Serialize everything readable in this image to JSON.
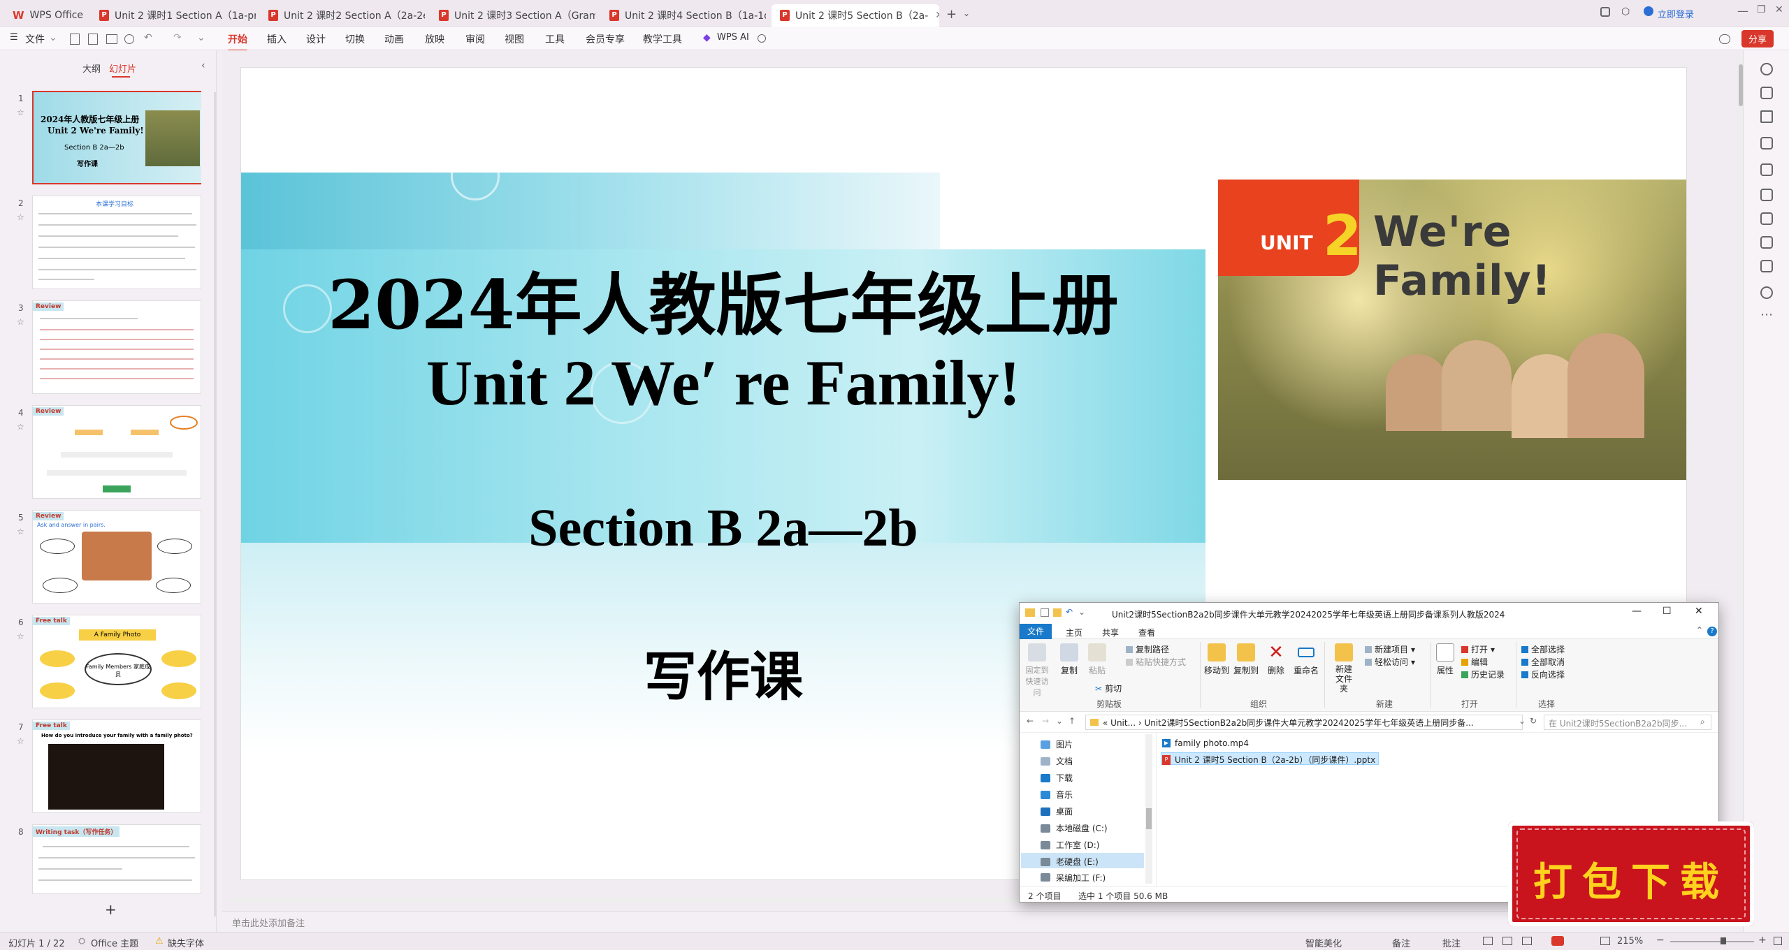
{
  "tabs": [
    {
      "label": "WPS Office",
      "type": "home"
    },
    {
      "label": "Unit 2 课时1 Section A（1a-pronun",
      "type": "ppt"
    },
    {
      "label": "Unit 2 课时2 Section A（2a-2e）",
      "type": "ppt"
    },
    {
      "label": "Unit 2 课时3 Section A（Grammar",
      "type": "ppt"
    },
    {
      "label": "Unit 2 课时4 Section B（1a-1d）",
      "type": "ppt"
    },
    {
      "label": "Unit 2 课时5 Section B（2a-",
      "type": "ppt",
      "active": true
    }
  ],
  "titlebar": {
    "login": "立即登录",
    "share": "分享"
  },
  "ribbon": {
    "file": "文件",
    "items": [
      "开始",
      "插入",
      "设计",
      "切换",
      "动画",
      "放映",
      "审阅",
      "视图",
      "工具",
      "会员专享",
      "教学工具"
    ],
    "active": "开始",
    "wps_ai": "WPS AI"
  },
  "leftpanel": {
    "tabs": [
      "大纲",
      "幻灯片"
    ],
    "active_tab": "幻灯片",
    "thumbs": [
      {
        "num": "1",
        "title": "2024年人教版七年级上册",
        "subtitle": "Unit 2 We're Family!",
        "section": "Section B 2a—2b",
        "footer": "写作课"
      },
      {
        "num": "2",
        "title": "本课学习目标"
      },
      {
        "num": "3",
        "title": "Review"
      },
      {
        "num": "4",
        "title": "Review"
      },
      {
        "num": "5",
        "title": "Review",
        "subtitle": "Ask and answer in pairs."
      },
      {
        "num": "6",
        "title": "Free talk",
        "subtitle": "A Family Photo",
        "center": "Family Members 家庭成员"
      },
      {
        "num": "7",
        "title": "Free talk",
        "subtitle": "How do you introduce your family with a family photo?"
      },
      {
        "num": "8",
        "title": "Writing task（写作任务）"
      }
    ],
    "add_icon": "plus-icon"
  },
  "slide": {
    "line1": "2024年人教版七年级上册",
    "line2": "Unit 2 We′ re Family!",
    "line3": "Section B 2a—2b",
    "line4": "写作课",
    "banner_unit": "UNIT",
    "banner_num": "2",
    "banner_title": "We're Family!"
  },
  "notes_placeholder": "单击此处添加备注",
  "status": {
    "slide_counter": "幻灯片 1 / 22",
    "theme": "Office 主题",
    "missing_font": "缺失字体",
    "beautify": "智能美化",
    "notes": "备注",
    "comments": "批注",
    "zoom": "215%"
  },
  "explorer": {
    "title": "Unit2课时5SectionB2a2b同步课件大单元教学20242025学年七年级英语上册同步备课系列人教版2024",
    "menu_tabs": [
      "文件",
      "主页",
      "共享",
      "查看"
    ],
    "groups": {
      "clipboard": {
        "label": "剪贴板",
        "pin": "固定到快速访问",
        "copy": "复制",
        "paste": "粘贴",
        "copy_path": "复制路径",
        "paste_shortcut": "粘贴快捷方式",
        "cut": "剪切"
      },
      "organize": {
        "label": "组织",
        "move_to": "移动到",
        "copy_to": "复制到",
        "delete": "删除",
        "rename": "重命名"
      },
      "new": {
        "label": "新建",
        "new_folder": "新建文件夹",
        "new_item": "新建项目",
        "easy_access": "轻松访问"
      },
      "open": {
        "label": "打开",
        "properties": "属性",
        "open": "打开",
        "edit": "编辑",
        "history": "历史记录"
      },
      "select": {
        "label": "选择",
        "select_all": "全部选择",
        "select_none": "全部取消",
        "invert": "反向选择"
      }
    },
    "address": "« Unit... › Unit2课时5SectionB2a2b同步课件大单元教学20242025学年七年级英语上册同步备...",
    "search_placeholder": "在 Unit2课时5SectionB2a2b同步...",
    "sidebar": [
      "图片",
      "文档",
      "下载",
      "音乐",
      "桌面",
      "本地磁盘 (C:)",
      "工作室 (D:)",
      "老硬盘 (E:)",
      "采编加工 (F:)"
    ],
    "sidebar_selected": "老硬盘 (E:)",
    "files": [
      {
        "name": "family photo.mp4",
        "kind": "video"
      },
      {
        "name": "Unit 2 课时5 Section B（2a-2b）（同步课件）.pptx",
        "kind": "pptx",
        "selected": true
      }
    ],
    "status_items": "2 个项目",
    "status_selected": "选中 1 个项目 50.6 MB"
  },
  "download_badge": "打包下载",
  "colors": {
    "accent": "#d9372b",
    "cyan": "#6fcfe0",
    "badge": "#c9141e"
  }
}
